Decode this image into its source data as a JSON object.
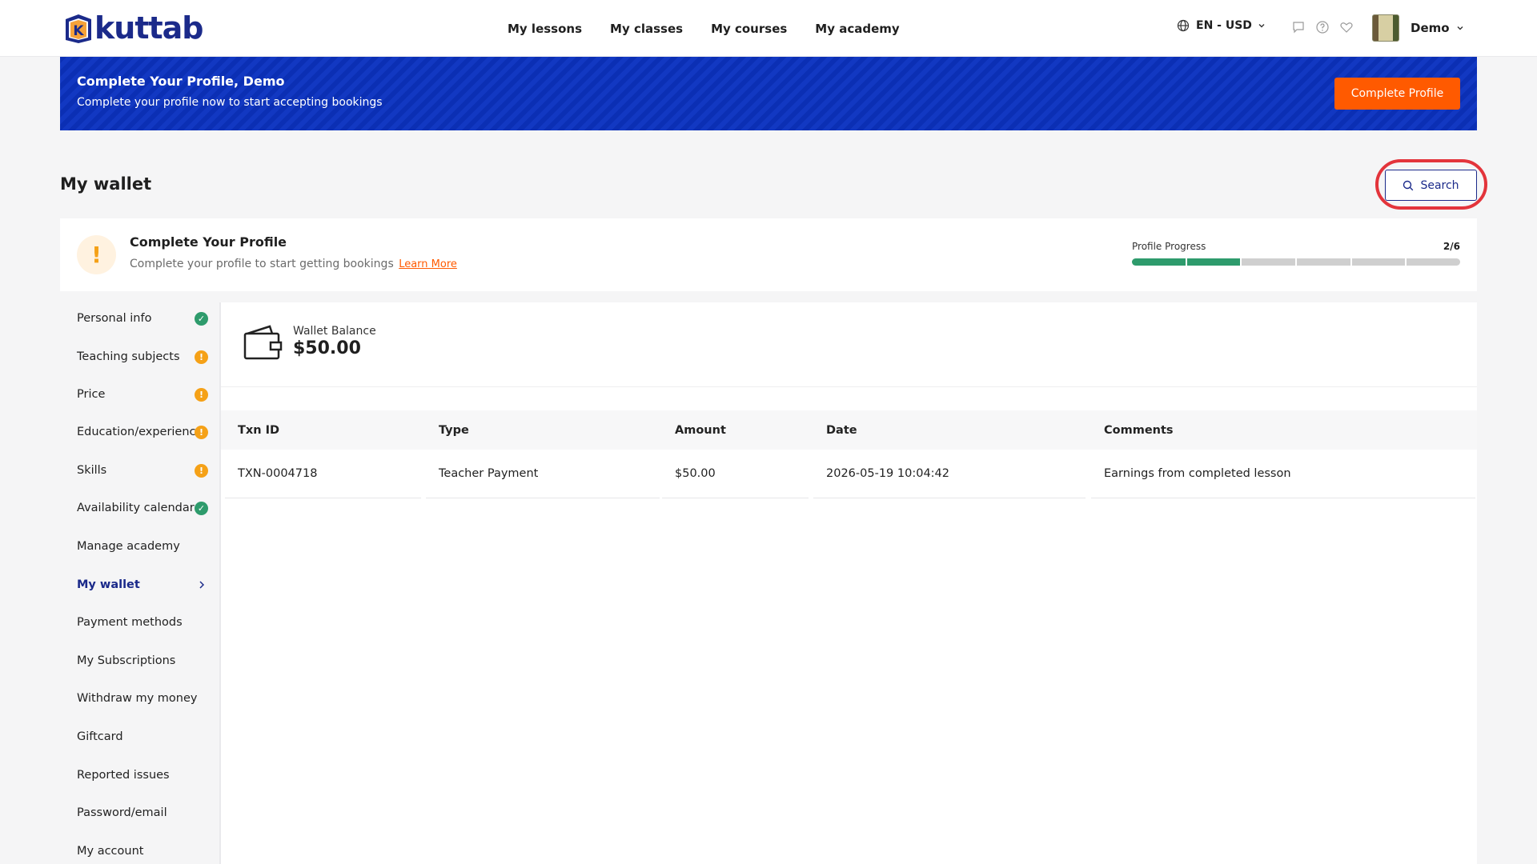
{
  "brand": {
    "name": "kuttab",
    "mark_letter": "K"
  },
  "nav": {
    "items": [
      "My lessons",
      "My classes",
      "My courses",
      "My academy"
    ]
  },
  "header": {
    "language_currency": "EN - USD",
    "icons": [
      "chat-icon",
      "help-icon",
      "heart-icon"
    ],
    "user_name": "Demo"
  },
  "banner": {
    "title": "Complete Your Profile, Demo",
    "subtitle": "Complete your profile now to start accepting bookings",
    "button": "Complete Profile",
    "color": "#0b2fb4",
    "button_color": "#ff5a00"
  },
  "page": {
    "title": "My wallet",
    "search_label": "Search"
  },
  "profile_card": {
    "title": "Complete Your Profile",
    "subtitle": "Complete your profile to start getting bookings",
    "link": "Learn More",
    "progress_label": "Profile Progress",
    "progress_text": "2/6",
    "progress_done": 2,
    "progress_total": 6
  },
  "sidebar": {
    "items": [
      {
        "label": "Personal info",
        "status": "ok"
      },
      {
        "label": "Teaching subjects",
        "status": "warn"
      },
      {
        "label": "Price",
        "status": "warn"
      },
      {
        "label": "Education/experience",
        "status": "warn"
      },
      {
        "label": "Skills",
        "status": "warn"
      },
      {
        "label": "Availability calendar",
        "status": "ok"
      },
      {
        "label": "Manage academy",
        "status": ""
      },
      {
        "label": "My wallet",
        "status": "active"
      },
      {
        "label": "Payment methods",
        "status": ""
      },
      {
        "label": "My Subscriptions",
        "status": ""
      },
      {
        "label": "Withdraw my money",
        "status": ""
      },
      {
        "label": "Giftcard",
        "status": ""
      },
      {
        "label": "Reported issues",
        "status": ""
      },
      {
        "label": "Password/email",
        "status": ""
      },
      {
        "label": "My account",
        "status": ""
      }
    ]
  },
  "wallet": {
    "label": "Wallet Balance",
    "balance": "$50.00"
  },
  "table": {
    "columns": [
      "Txn ID",
      "Type",
      "Amount",
      "Date",
      "Comments"
    ],
    "rows": [
      [
        "TXN-0004718",
        "Teacher Payment",
        "$50.00",
        "2026-05-19 10:04:42",
        "Earnings from completed lesson"
      ]
    ]
  }
}
